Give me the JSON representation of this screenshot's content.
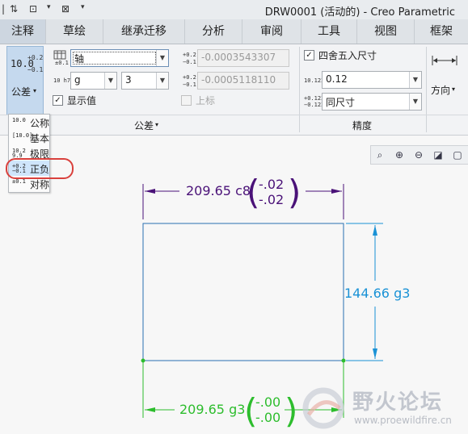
{
  "titlebar": {
    "title": "DRW0001 (活动的) - Creo Parametric",
    "quick_access": [
      "⇅",
      "⊡",
      "▾",
      "⊠",
      "▾"
    ]
  },
  "tabs": [
    "注释",
    "草绘",
    "继承迁移",
    "分析",
    "审阅",
    "工具",
    "视图",
    "框架"
  ],
  "ribbon": {
    "tolerance_group": {
      "label": "公差",
      "big_button_label": "公差",
      "big_icon_main": "10.0",
      "big_icon_sup": "+0.2",
      "big_icon_sub": "−0.1",
      "fit_type_value": "轴",
      "fit_icon_text": "±0.1",
      "upper_icon_text": "+0.2",
      "lower_icon_text": "−0.1",
      "upper_value": "-0.0003543307",
      "lower_value": "-0.0005118110",
      "class_icon_text": "10 h7",
      "class_letter": "g",
      "class_grade": "3",
      "show_value_label": "显示值",
      "show_value_checked": true,
      "superscript_label": "上标",
      "superscript_checked": false
    },
    "precision_group": {
      "label": "精度",
      "round_label": "四舍五入尺寸",
      "round_checked": true,
      "decimals_icon": "10.123",
      "decimals_value": "0.12",
      "tol_decimals_icon": "+0.123 −0.123",
      "tol_decimals_value": "同尺寸"
    },
    "direction_group": {
      "label": "方向"
    }
  },
  "tolerance_menu": {
    "items": [
      {
        "icon": "10.0",
        "label": "公称"
      },
      {
        "icon": "[10.0]",
        "label": "基本"
      },
      {
        "icon": "10.2 9.9",
        "label": "极限"
      },
      {
        "icon": "+0.2 −0.1",
        "label": "正负",
        "selected": true
      },
      {
        "icon": "±0.1",
        "label": "对称"
      }
    ]
  },
  "view_tools": [
    "zoom-window-icon",
    "zoom-in-icon",
    "zoom-out-icon",
    "refit-icon",
    "repaint-icon"
  ],
  "drawing": {
    "colors": {
      "selected_dim": "#4a1278",
      "active_dim": "#1a92d6",
      "new_dim": "#2dbd2d",
      "geometry": "#2a6fb0"
    },
    "top_dim": {
      "value": "209.65 c8",
      "upper": "-.02",
      "lower": "-.02"
    },
    "right_dim": {
      "value": "144.66 g3"
    },
    "bottom_dim": {
      "value": "209.65 g3",
      "upper": "-.00",
      "lower": "-.00"
    }
  },
  "watermark": {
    "text": "野火论坛",
    "url": "www.proewildfire.cn"
  }
}
